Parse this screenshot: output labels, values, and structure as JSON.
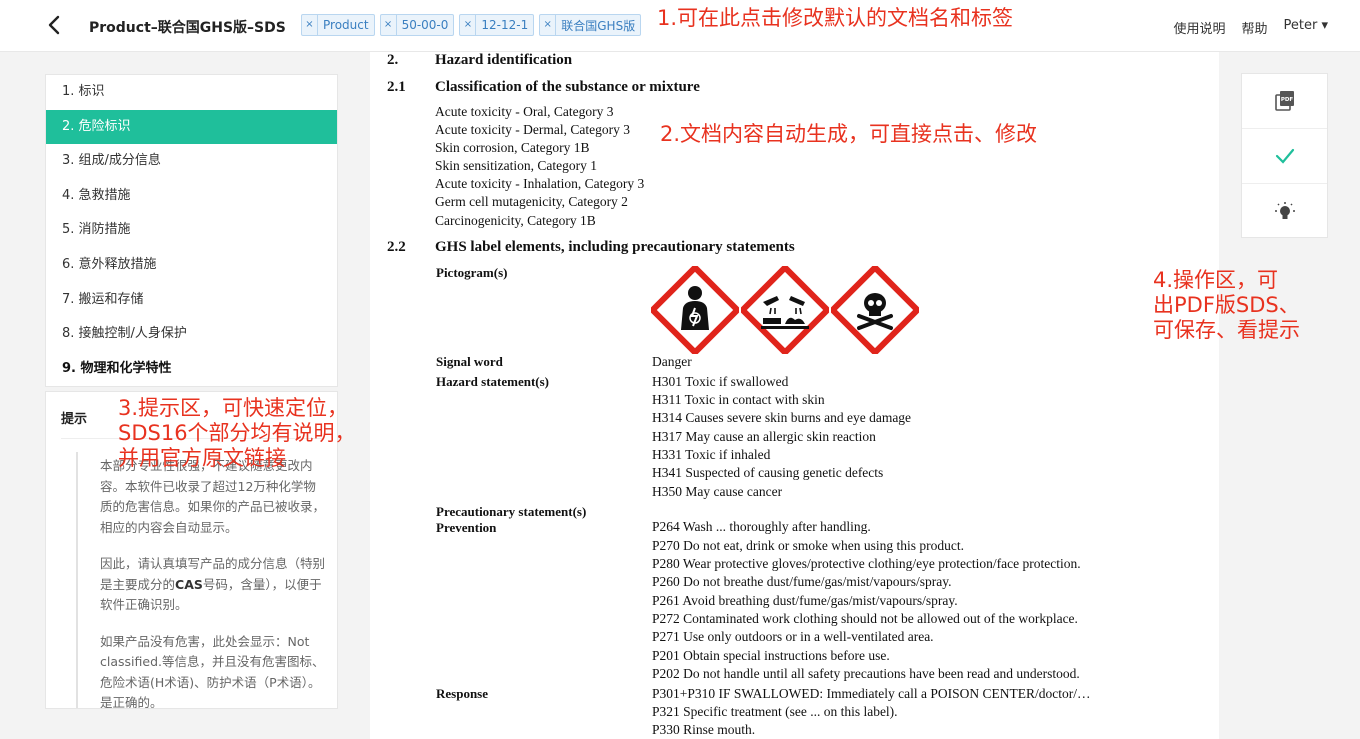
{
  "header": {
    "back_icon": "chevron-left-icon",
    "title": "Product–联合国GHS版–SDS",
    "tags": [
      "Product",
      "50-00-0",
      "12-12-1",
      "联合国GHS版"
    ],
    "tag_remove": "×",
    "help_text": "使用说明",
    "help": "帮助",
    "user": "Peter ▾"
  },
  "annotations": {
    "a1": "1.可在此点击修改默认的文档名和标签",
    "a2": "2.文档内容自动生成，可直接点击、修改",
    "a3": [
      "3.提示区，可快速定位，",
      "SDS16个部分均有说明，",
      "并用官方原文链接"
    ],
    "a4": [
      "4.操作区，可",
      "出PDF版SDS、",
      "可保存、看提示"
    ]
  },
  "toc": [
    "1. 标识",
    "2. 危险标识",
    "3. 组成/成分信息",
    "4. 急救措施",
    "5. 消防措施",
    "6. 意外释放措施",
    "7. 搬运和存储",
    "8. 接触控制/人身保护",
    "9. 物理和化学特性"
  ],
  "hint": {
    "title": "提示",
    "p1": "本部分专业性很强，不建议随意更改内容。本软件已收录了超过12万种化学物质的危害信息。如果你的产品已被收录，相应的内容会自动显示。",
    "p2_a": "因此，请认真填写产品的成分信息（特别是主要成分的",
    "p2_b": "CAS",
    "p2_c": "号码，含量），以便于软件正确识别。",
    "p3": "如果产品没有危害，此处会显示：Not classified.等信息，并且没有危害图标、危险术语(H术语)、防护术语（P术语）。是正确的。"
  },
  "doc": {
    "s2_num": "2.",
    "s2_title": "Hazard identification",
    "s21_num": "2.1",
    "s21_title": "Classification of the substance or mixture",
    "classification": [
      "Acute toxicity - Oral, Category 3",
      "Acute toxicity - Dermal, Category 3",
      "Skin corrosion, Category 1B",
      "Skin sensitization, Category 1",
      "Acute toxicity - Inhalation, Category 3",
      "Germ cell mutagenicity, Category 2",
      "Carcinogenicity, Category 1B"
    ],
    "s22_num": "2.2",
    "s22_title": "GHS label elements, including precautionary statements",
    "pictogram_label": "Pictogram(s)",
    "pictograms": [
      "health-hazard-pictogram",
      "corrosion-pictogram",
      "skull-crossbones-pictogram"
    ],
    "signal_label": "Signal word",
    "signal_word": "Danger",
    "hazard_label": "Hazard statement(s)",
    "hazards": [
      "H301 Toxic if swallowed",
      "H311 Toxic in contact with skin",
      "H314 Causes severe skin burns and eye damage",
      "H317 May cause an allergic skin reaction",
      "H331 Toxic if inhaled",
      "H341 Suspected of causing genetic defects",
      "H350 May cause cancer"
    ],
    "precaution_label": "Precautionary statement(s)",
    "prevention_label": "Prevention",
    "prevention": [
      "P264 Wash ... thoroughly after handling.",
      "P270 Do not eat, drink or smoke when using this product.",
      "P280 Wear protective gloves/protective clothing/eye protection/face protection.",
      "P260 Do not breathe dust/fume/gas/mist/vapours/spray.",
      "P261 Avoid breathing dust/fume/gas/mist/vapours/spray.",
      "P272 Contaminated work clothing should not be allowed out of the workplace.",
      "P271 Use only outdoors or in a well-ventilated area.",
      "P201 Obtain special instructions before use.",
      "P202 Do not handle until all safety precautions have been read and understood."
    ],
    "response_label": "Response",
    "response": [
      "P301+P310 IF SWALLOWED: Immediately call a POISON CENTER/doctor/…",
      "P321 Specific treatment (see ... on this label).",
      "P330 Rinse mouth."
    ]
  },
  "actions": [
    "pdf-icon",
    "check-icon",
    "lightbulb-icon"
  ],
  "colors": {
    "accent": "#1fbf9b",
    "annotation": "#e8321f",
    "tag": "#3a7fc0",
    "ghs_red": "#e0241b"
  }
}
